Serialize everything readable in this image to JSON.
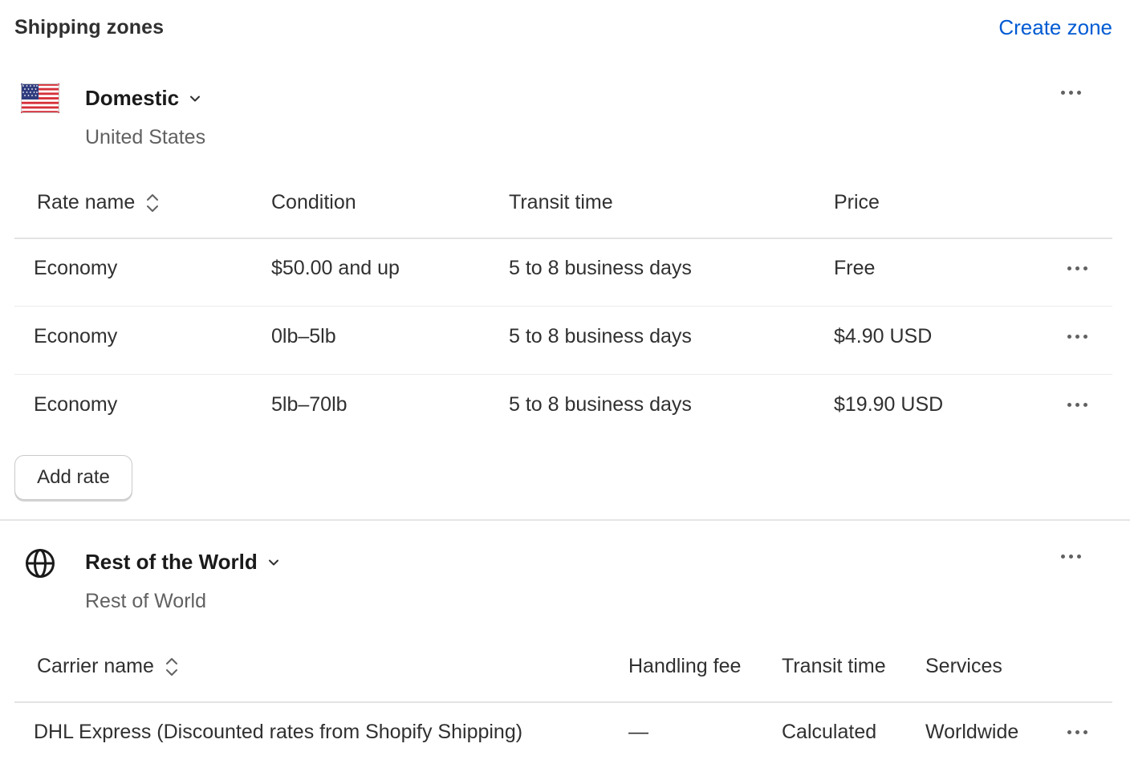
{
  "header": {
    "title": "Shipping zones",
    "create_zone_label": "Create zone"
  },
  "zones": [
    {
      "name": "Domestic",
      "region": "United States",
      "icon": "us-flag-icon",
      "columns": [
        "Rate name",
        "Condition",
        "Transit time",
        "Price"
      ],
      "rows": [
        {
          "rate_name": "Economy",
          "condition": "$50.00 and up",
          "transit": "5 to 8 business days",
          "price": "Free"
        },
        {
          "rate_name": "Economy",
          "condition": "0lb–5lb",
          "transit": "5 to 8 business days",
          "price": "$4.90 USD"
        },
        {
          "rate_name": "Economy",
          "condition": "5lb–70lb",
          "transit": "5 to 8 business days",
          "price": "$19.90 USD"
        }
      ],
      "add_rate_label": "Add rate"
    },
    {
      "name": "Rest of the World",
      "region": "Rest of World",
      "icon": "globe-icon",
      "columns": [
        "Carrier name",
        "Handling fee",
        "Transit time",
        "Services"
      ],
      "rows": [
        {
          "carrier_name": "DHL Express (Discounted rates from Shopify Shipping)",
          "handling_fee": "—",
          "transit": "Calculated",
          "services": "Worldwide"
        }
      ]
    }
  ],
  "colors": {
    "link": "#005bd3",
    "text": "#303030",
    "subdued": "#616161",
    "divider": "#e3e3e3"
  }
}
